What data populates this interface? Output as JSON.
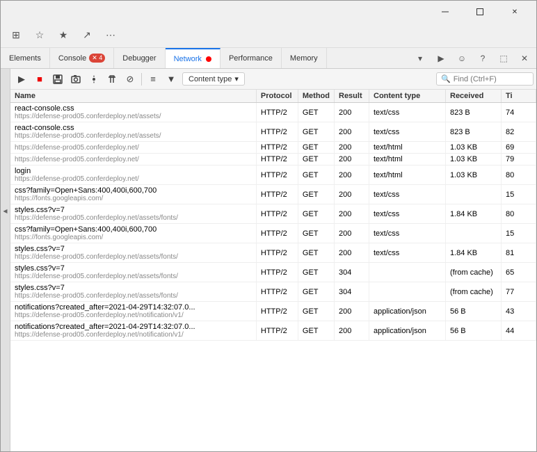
{
  "window": {
    "titlebar": {
      "minimize_label": "─",
      "maximize_label": "⬜",
      "close_label": "✕"
    }
  },
  "browser_toolbar": {
    "btn_back": "‹",
    "btn_forward": "›",
    "btn_refresh": "↻",
    "btn_more1": "⊞",
    "btn_star": "☆",
    "btn_fav": "★",
    "btn_share": "↗",
    "btn_more2": "⋯"
  },
  "devtools": {
    "tabs": [
      {
        "id": "elements",
        "label": "Elements",
        "active": false,
        "badge": null
      },
      {
        "id": "console",
        "label": "Console",
        "active": false,
        "badge": "✕ 4"
      },
      {
        "id": "debugger",
        "label": "Debugger",
        "active": false,
        "badge": null
      },
      {
        "id": "network",
        "label": "Network",
        "active": true,
        "badge": null,
        "recording": true
      },
      {
        "id": "performance",
        "label": "Performance",
        "active": false,
        "badge": null
      },
      {
        "id": "memory",
        "label": "Memory",
        "active": false,
        "badge": null
      }
    ],
    "tab_icons": [
      "▾",
      "▶",
      "☺",
      "?",
      "⬚",
      "✕"
    ]
  },
  "network_toolbar": {
    "buttons": [
      {
        "id": "play",
        "icon": "▶",
        "active": false
      },
      {
        "id": "stop",
        "icon": "■",
        "active": false,
        "red": true
      },
      {
        "id": "save",
        "icon": "💾",
        "active": false
      },
      {
        "id": "snapshot",
        "icon": "📷",
        "active": false
      },
      {
        "id": "settings",
        "icon": "⚙",
        "active": false
      },
      {
        "id": "trash",
        "icon": "🗑",
        "active": false
      },
      {
        "id": "block",
        "icon": "⊘",
        "active": false
      },
      {
        "id": "list",
        "icon": "≡",
        "active": false
      },
      {
        "id": "filter",
        "icon": "▼",
        "active": false
      }
    ],
    "content_type_label": "Content type",
    "search_placeholder": "Find (Ctrl+F)"
  },
  "table": {
    "headers": [
      "Name",
      "Protocol",
      "Method",
      "Result",
      "Content type",
      "Received",
      "Ti"
    ],
    "rows": [
      {
        "name": "react-console.css",
        "url": "https://defense-prod05.conferdeploy.net/assets/",
        "protocol": "HTTP/2",
        "method": "GET",
        "result": "200",
        "content_type": "text/css",
        "received": "823 B",
        "time": "74"
      },
      {
        "name": "react-console.css",
        "url": "https://defense-prod05.conferdeploy.net/assets/",
        "protocol": "HTTP/2",
        "method": "GET",
        "result": "200",
        "content_type": "text/css",
        "received": "823 B",
        "time": "82"
      },
      {
        "name": "",
        "url": "https://defense-prod05.conferdeploy.net/",
        "protocol": "HTTP/2",
        "method": "GET",
        "result": "200",
        "content_type": "text/html",
        "received": "1.03 KB",
        "time": "69"
      },
      {
        "name": "",
        "url": "https://defense-prod05.conferdeploy.net/",
        "protocol": "HTTP/2",
        "method": "GET",
        "result": "200",
        "content_type": "text/html",
        "received": "1.03 KB",
        "time": "79"
      },
      {
        "name": "login",
        "url": "https://defense-prod05.conferdeploy.net/",
        "protocol": "HTTP/2",
        "method": "GET",
        "result": "200",
        "content_type": "text/html",
        "received": "1.03 KB",
        "time": "80"
      },
      {
        "name": "css?family=Open+Sans:400,400i,600,700",
        "url": "https://fonts.googleapis.com/",
        "protocol": "HTTP/2",
        "method": "GET",
        "result": "200",
        "content_type": "text/css",
        "received": "",
        "time": "15"
      },
      {
        "name": "styles.css?v=7",
        "url": "https://defense-prod05.conferdeploy.net/assets/fonts/",
        "protocol": "HTTP/2",
        "method": "GET",
        "result": "200",
        "content_type": "text/css",
        "received": "1.84 KB",
        "time": "80"
      },
      {
        "name": "css?family=Open+Sans:400,400i,600,700",
        "url": "https://fonts.googleapis.com/",
        "protocol": "HTTP/2",
        "method": "GET",
        "result": "200",
        "content_type": "text/css",
        "received": "",
        "time": "15"
      },
      {
        "name": "styles.css?v=7",
        "url": "https://defense-prod05.conferdeploy.net/assets/fonts/",
        "protocol": "HTTP/2",
        "method": "GET",
        "result": "200",
        "content_type": "text/css",
        "received": "1.84 KB",
        "time": "81"
      },
      {
        "name": "styles.css?v=7",
        "url": "https://defense-prod05.conferdeploy.net/assets/fonts/",
        "protocol": "HTTP/2",
        "method": "GET",
        "result": "304",
        "content_type": "",
        "received": "(from cache)",
        "time": "65"
      },
      {
        "name": "styles.css?v=7",
        "url": "https://defense-prod05.conferdeploy.net/assets/fonts/",
        "protocol": "HTTP/2",
        "method": "GET",
        "result": "304",
        "content_type": "",
        "received": "(from cache)",
        "time": "77"
      },
      {
        "name": "notifications?created_after=2021-04-29T14:32:07.0...",
        "url": "https://defense-prod05.conferdeploy.net/notification/v1/",
        "protocol": "HTTP/2",
        "method": "GET",
        "result": "200",
        "content_type": "application/json",
        "received": "56 B",
        "time": "43"
      },
      {
        "name": "notifications?created_after=2021-04-29T14:32:07.0...",
        "url": "https://defense-prod05.conferdeploy.net/notification/v1/",
        "protocol": "HTTP/2",
        "method": "GET",
        "result": "200",
        "content_type": "application/json",
        "received": "56 B",
        "time": "44"
      }
    ]
  }
}
